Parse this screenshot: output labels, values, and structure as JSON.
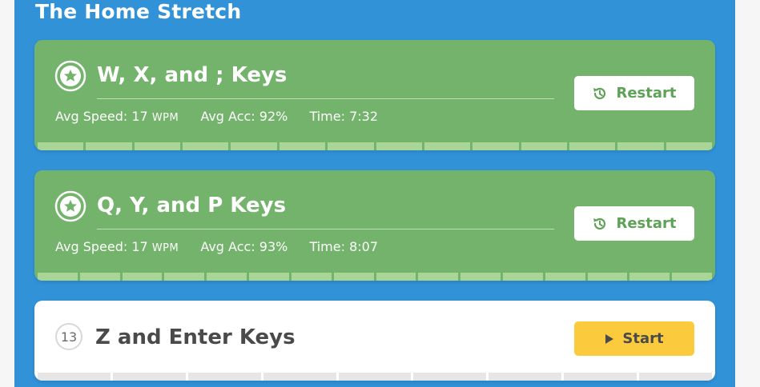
{
  "section": {
    "title": "The Home Stretch"
  },
  "lessons": [
    {
      "title": "W, X, and ; Keys",
      "status": "completed",
      "stats": {
        "speed_label": "Avg Speed:",
        "speed_value": "17",
        "speed_unit": "WPM",
        "acc_label": "Avg Acc:",
        "acc_value": "92%",
        "time_label": "Time:",
        "time_value": "7:32"
      },
      "button_label": "Restart",
      "progress_fraction": 1.0
    },
    {
      "title": "Q, Y, and P Keys",
      "status": "completed",
      "stats": {
        "speed_label": "Avg Speed:",
        "speed_value": "17",
        "speed_unit": "WPM",
        "acc_label": "Avg Acc:",
        "acc_value": "93%",
        "time_label": "Time:",
        "time_value": "8:07"
      },
      "button_label": "Restart",
      "progress_fraction": 1.0
    },
    {
      "number": "13",
      "title": "Z and Enter Keys",
      "status": "not-started",
      "button_label": "Start",
      "progress_fraction": 0.0
    }
  ],
  "colors": {
    "panel_blue": "#3192d8",
    "completed_green": "#73b36b",
    "progress_green": "#a9d597",
    "start_yellow": "#fccb3d"
  },
  "icons": {
    "completed_badge": "star-icon",
    "restart": "history-icon",
    "start": "play-icon"
  }
}
